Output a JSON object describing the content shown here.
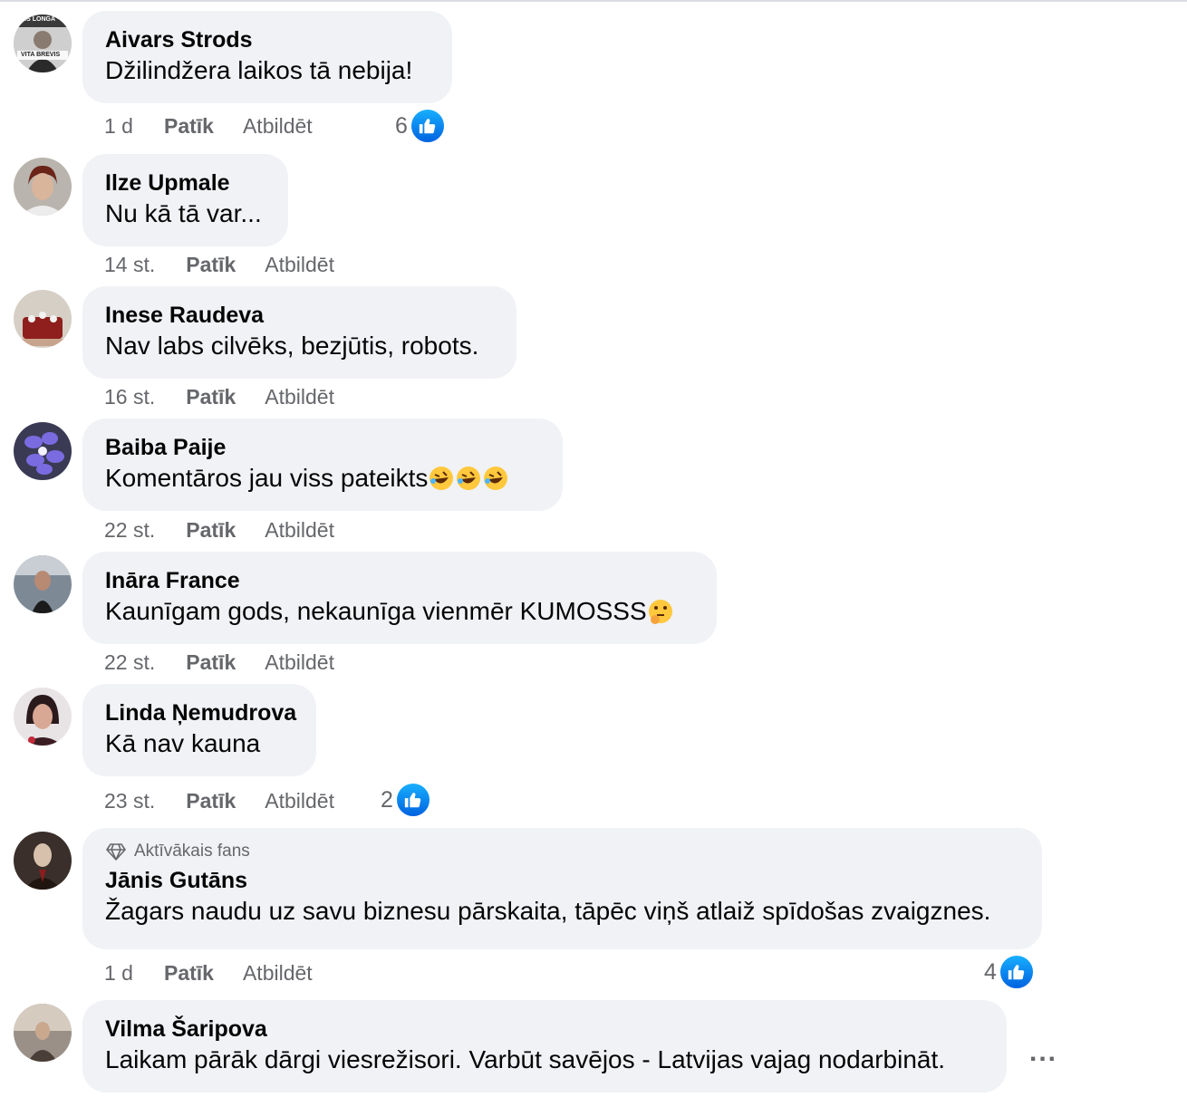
{
  "actions": {
    "like": "Patīk",
    "reply": "Atbildēt"
  },
  "badge_label": "Aktīvākais fans",
  "comments": [
    {
      "author": "Aivars Strods",
      "text": "Džilindžera laikos tā nebija!",
      "time": "1 d",
      "reactions": "6"
    },
    {
      "author": "Ilze Upmale",
      "text": "Nu kā tā var...",
      "time": "14 st."
    },
    {
      "author": "Inese Raudeva",
      "text": "Nav labs cilvēks, bezjūtis, robots.",
      "time": "16 st."
    },
    {
      "author": "Baiba Paije",
      "text": "Komentāros jau viss pateikts",
      "time": "22 st.",
      "emojis": [
        "rolling-laughing-emoji",
        "rolling-laughing-emoji",
        "rolling-laughing-emoji"
      ]
    },
    {
      "author": "Ināra France",
      "text": "Kaunīgam gods, nekaunīga vienmēr KUMOSSS",
      "time": "22 st.",
      "emojis": [
        "thinking-emoji"
      ]
    },
    {
      "author": "Linda Ņemudrova",
      "text": "Kā nav kauna",
      "time": "23 st.",
      "reactions": "2"
    },
    {
      "author": "Jānis Gutāns",
      "text": "Žagars naudu uz savu biznesu pārskaita, tāpēc viņš atlaiž spīdošas zvaigznes.",
      "time": "1 d",
      "reactions": "4",
      "badge": true
    },
    {
      "author": "Vilma Šaripova",
      "text": "Laikam pārāk dārgi viesrežisori. Varbūt savējos - Latvijas vajag nodarbināt."
    }
  ],
  "avatar_badge": {
    "line1": "ARS LONGA",
    "line2": "VITA BREVIS"
  },
  "more_label": "...",
  "colors": {
    "bubble": "#f0f2f5",
    "meta": "#65676b",
    "like_blue": "#1877f2"
  }
}
